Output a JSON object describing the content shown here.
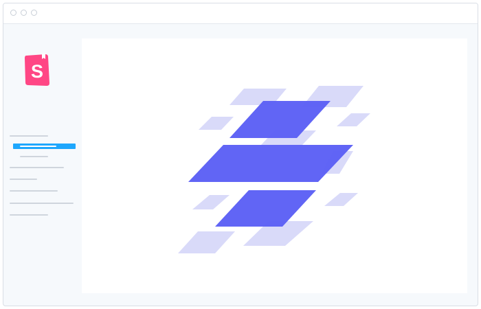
{
  "app": {
    "logo_letter": "S",
    "brand_color": "#ff4785",
    "accent_color": "#1ea7fd",
    "illustration_primary": "#5b5ff5",
    "illustration_secondary": "#d9daf9"
  },
  "titlebar": {
    "buttons": [
      "close-dot",
      "minimize-dot",
      "maximize-dot"
    ]
  },
  "sidebar": {
    "logo_icon": "storybook-logo-icon",
    "items": [
      {
        "name": "sidebar-item-1",
        "state": "normal"
      },
      {
        "name": "sidebar-item-2",
        "state": "selected"
      },
      {
        "name": "sidebar-item-3",
        "state": "normal"
      },
      {
        "name": "sidebar-item-4",
        "state": "normal"
      },
      {
        "name": "sidebar-item-5",
        "state": "normal"
      },
      {
        "name": "sidebar-item-6",
        "state": "normal"
      },
      {
        "name": "sidebar-item-7",
        "state": "normal"
      },
      {
        "name": "sidebar-item-8",
        "state": "normal"
      }
    ]
  },
  "canvas": {
    "illustration_icon": "stacked-layers-illustration-icon"
  }
}
